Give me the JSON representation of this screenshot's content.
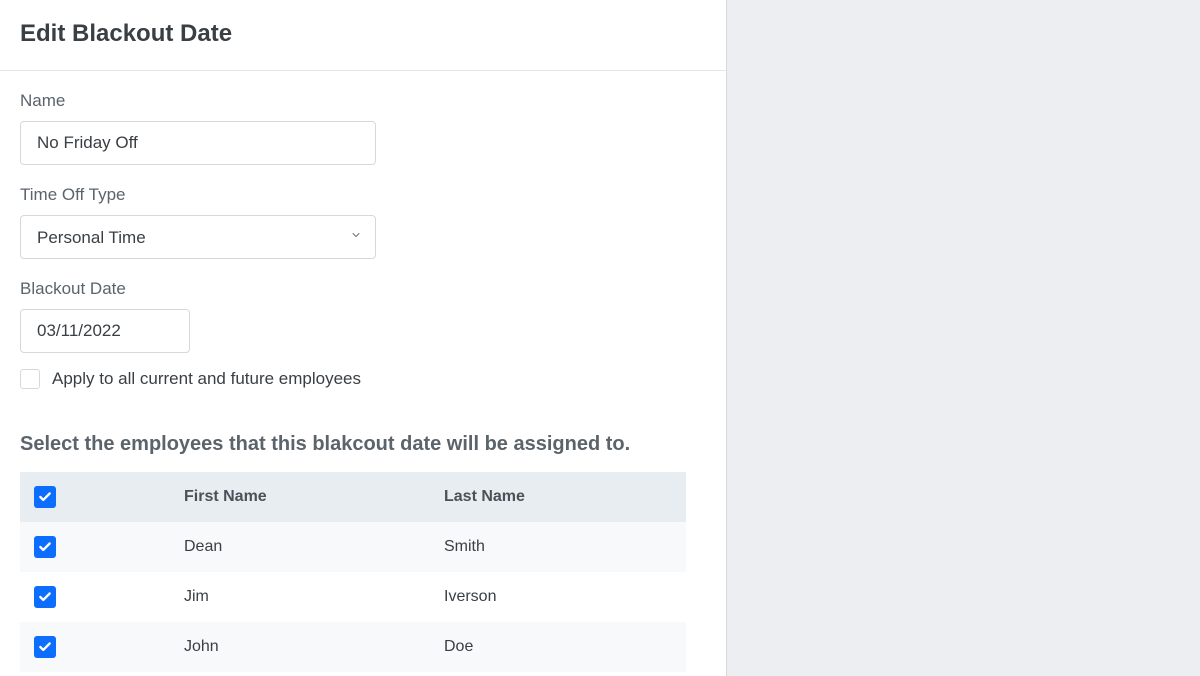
{
  "page": {
    "title": "Edit Blackout Date"
  },
  "form": {
    "name": {
      "label": "Name",
      "value": "No Friday Off"
    },
    "time_off_type": {
      "label": "Time Off Type",
      "value": "Personal Time"
    },
    "blackout_date": {
      "label": "Blackout Date",
      "value": "03/11/2022"
    },
    "apply_all": {
      "label": "Apply to all current and future employees",
      "checked": false
    }
  },
  "employees_section": {
    "title": "Select the employees that this blakcout date will be assigned to.",
    "columns": {
      "first": "First Name",
      "last": "Last Name"
    },
    "select_all_checked": true,
    "rows": [
      {
        "first": "Dean",
        "last": "Smith",
        "checked": true
      },
      {
        "first": "Jim",
        "last": "Iverson",
        "checked": true
      },
      {
        "first": "John",
        "last": "Doe",
        "checked": true
      }
    ]
  }
}
